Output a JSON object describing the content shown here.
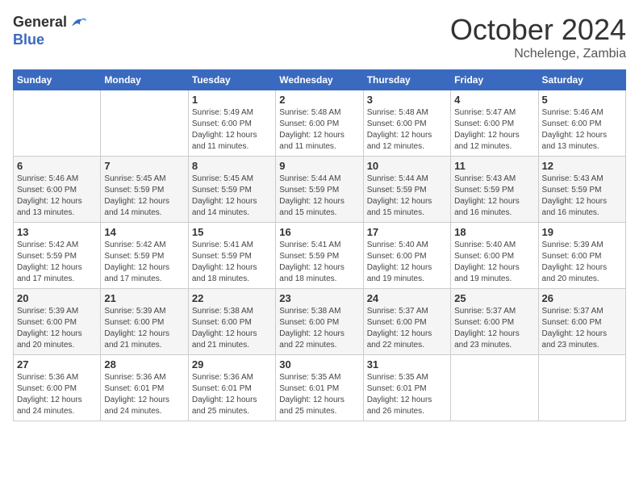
{
  "logo": {
    "general": "General",
    "blue": "Blue"
  },
  "header": {
    "month": "October 2024",
    "location": "Nchelenge, Zambia"
  },
  "weekdays": [
    "Sunday",
    "Monday",
    "Tuesday",
    "Wednesday",
    "Thursday",
    "Friday",
    "Saturday"
  ],
  "weeks": [
    [
      {
        "day": "",
        "info": ""
      },
      {
        "day": "",
        "info": ""
      },
      {
        "day": "1",
        "info": "Sunrise: 5:49 AM\nSunset: 6:00 PM\nDaylight: 12 hours and 11 minutes."
      },
      {
        "day": "2",
        "info": "Sunrise: 5:48 AM\nSunset: 6:00 PM\nDaylight: 12 hours and 11 minutes."
      },
      {
        "day": "3",
        "info": "Sunrise: 5:48 AM\nSunset: 6:00 PM\nDaylight: 12 hours and 12 minutes."
      },
      {
        "day": "4",
        "info": "Sunrise: 5:47 AM\nSunset: 6:00 PM\nDaylight: 12 hours and 12 minutes."
      },
      {
        "day": "5",
        "info": "Sunrise: 5:46 AM\nSunset: 6:00 PM\nDaylight: 12 hours and 13 minutes."
      }
    ],
    [
      {
        "day": "6",
        "info": "Sunrise: 5:46 AM\nSunset: 6:00 PM\nDaylight: 12 hours and 13 minutes."
      },
      {
        "day": "7",
        "info": "Sunrise: 5:45 AM\nSunset: 5:59 PM\nDaylight: 12 hours and 14 minutes."
      },
      {
        "day": "8",
        "info": "Sunrise: 5:45 AM\nSunset: 5:59 PM\nDaylight: 12 hours and 14 minutes."
      },
      {
        "day": "9",
        "info": "Sunrise: 5:44 AM\nSunset: 5:59 PM\nDaylight: 12 hours and 15 minutes."
      },
      {
        "day": "10",
        "info": "Sunrise: 5:44 AM\nSunset: 5:59 PM\nDaylight: 12 hours and 15 minutes."
      },
      {
        "day": "11",
        "info": "Sunrise: 5:43 AM\nSunset: 5:59 PM\nDaylight: 12 hours and 16 minutes."
      },
      {
        "day": "12",
        "info": "Sunrise: 5:43 AM\nSunset: 5:59 PM\nDaylight: 12 hours and 16 minutes."
      }
    ],
    [
      {
        "day": "13",
        "info": "Sunrise: 5:42 AM\nSunset: 5:59 PM\nDaylight: 12 hours and 17 minutes."
      },
      {
        "day": "14",
        "info": "Sunrise: 5:42 AM\nSunset: 5:59 PM\nDaylight: 12 hours and 17 minutes."
      },
      {
        "day": "15",
        "info": "Sunrise: 5:41 AM\nSunset: 5:59 PM\nDaylight: 12 hours and 18 minutes."
      },
      {
        "day": "16",
        "info": "Sunrise: 5:41 AM\nSunset: 5:59 PM\nDaylight: 12 hours and 18 minutes."
      },
      {
        "day": "17",
        "info": "Sunrise: 5:40 AM\nSunset: 6:00 PM\nDaylight: 12 hours and 19 minutes."
      },
      {
        "day": "18",
        "info": "Sunrise: 5:40 AM\nSunset: 6:00 PM\nDaylight: 12 hours and 19 minutes."
      },
      {
        "day": "19",
        "info": "Sunrise: 5:39 AM\nSunset: 6:00 PM\nDaylight: 12 hours and 20 minutes."
      }
    ],
    [
      {
        "day": "20",
        "info": "Sunrise: 5:39 AM\nSunset: 6:00 PM\nDaylight: 12 hours and 20 minutes."
      },
      {
        "day": "21",
        "info": "Sunrise: 5:39 AM\nSunset: 6:00 PM\nDaylight: 12 hours and 21 minutes."
      },
      {
        "day": "22",
        "info": "Sunrise: 5:38 AM\nSunset: 6:00 PM\nDaylight: 12 hours and 21 minutes."
      },
      {
        "day": "23",
        "info": "Sunrise: 5:38 AM\nSunset: 6:00 PM\nDaylight: 12 hours and 22 minutes."
      },
      {
        "day": "24",
        "info": "Sunrise: 5:37 AM\nSunset: 6:00 PM\nDaylight: 12 hours and 22 minutes."
      },
      {
        "day": "25",
        "info": "Sunrise: 5:37 AM\nSunset: 6:00 PM\nDaylight: 12 hours and 23 minutes."
      },
      {
        "day": "26",
        "info": "Sunrise: 5:37 AM\nSunset: 6:00 PM\nDaylight: 12 hours and 23 minutes."
      }
    ],
    [
      {
        "day": "27",
        "info": "Sunrise: 5:36 AM\nSunset: 6:00 PM\nDaylight: 12 hours and 24 minutes."
      },
      {
        "day": "28",
        "info": "Sunrise: 5:36 AM\nSunset: 6:01 PM\nDaylight: 12 hours and 24 minutes."
      },
      {
        "day": "29",
        "info": "Sunrise: 5:36 AM\nSunset: 6:01 PM\nDaylight: 12 hours and 25 minutes."
      },
      {
        "day": "30",
        "info": "Sunrise: 5:35 AM\nSunset: 6:01 PM\nDaylight: 12 hours and 25 minutes."
      },
      {
        "day": "31",
        "info": "Sunrise: 5:35 AM\nSunset: 6:01 PM\nDaylight: 12 hours and 26 minutes."
      },
      {
        "day": "",
        "info": ""
      },
      {
        "day": "",
        "info": ""
      }
    ]
  ]
}
